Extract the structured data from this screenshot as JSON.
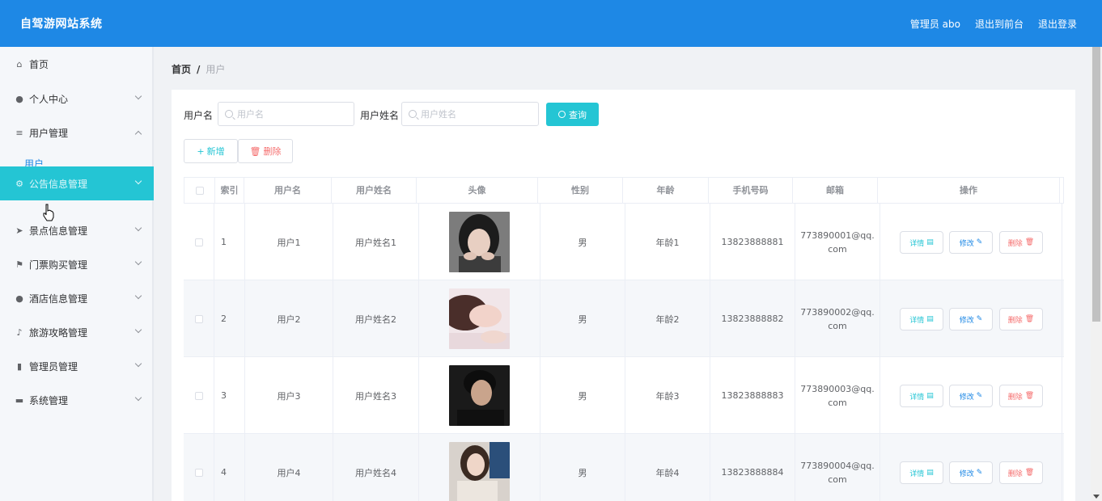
{
  "header": {
    "title": "自驾游网站系统",
    "admin_label": "管理员 abo",
    "back_label": "退出到前台",
    "logout_label": "退出登录"
  },
  "sidebar": {
    "items": [
      {
        "label": "首页",
        "icon": "home-icon"
      },
      {
        "label": "个人中心",
        "icon": "user-icon"
      },
      {
        "label": "用户管理",
        "icon": "list-icon"
      },
      {
        "label": "公告信息管理",
        "icon": "settings-icon"
      },
      {
        "label": "景点信息管理",
        "icon": "location-icon"
      },
      {
        "label": "门票购买管理",
        "icon": "flag-icon"
      },
      {
        "label": "酒店信息管理",
        "icon": "user-icon"
      },
      {
        "label": "旅游攻略管理",
        "icon": "bell-off-icon"
      },
      {
        "label": "管理员管理",
        "icon": "bar-chart-icon"
      },
      {
        "label": "系统管理",
        "icon": "chat-icon"
      }
    ],
    "sub_item": "用户",
    "active_index": 3
  },
  "breadcrumb": {
    "home": "首页",
    "separator": "/",
    "current": "用户"
  },
  "search": {
    "username_label": "用户名",
    "username_placeholder": "用户名",
    "name_label": "用户姓名",
    "name_placeholder": "用户姓名",
    "query_button": "查询"
  },
  "actions": {
    "add_button": "新增",
    "delete_button": "删除"
  },
  "table": {
    "columns": [
      "索引",
      "用户名",
      "用户姓名",
      "头像",
      "性别",
      "年龄",
      "手机号码",
      "邮箱",
      "操作"
    ],
    "rows": [
      {
        "index": "1",
        "username": "用户1",
        "name": "用户姓名1",
        "gender": "男",
        "age": "年龄1",
        "phone": "13823888881",
        "email": "773890001@qq.com"
      },
      {
        "index": "2",
        "username": "用户2",
        "name": "用户姓名2",
        "gender": "男",
        "age": "年龄2",
        "phone": "13823888882",
        "email": "773890002@qq.com"
      },
      {
        "index": "3",
        "username": "用户3",
        "name": "用户姓名3",
        "gender": "男",
        "age": "年龄3",
        "phone": "13823888883",
        "email": "773890003@qq.com"
      },
      {
        "index": "4",
        "username": "用户4",
        "name": "用户姓名4",
        "gender": "男",
        "age": "年龄4",
        "phone": "13823888884",
        "email": "773890004@qq.com"
      }
    ],
    "row_actions": {
      "detail": "详情",
      "edit": "修改",
      "delete": "删除"
    }
  },
  "colors": {
    "header_bg": "#1e88e5",
    "accent": "#24c5d4",
    "danger": "#f56c6c"
  }
}
